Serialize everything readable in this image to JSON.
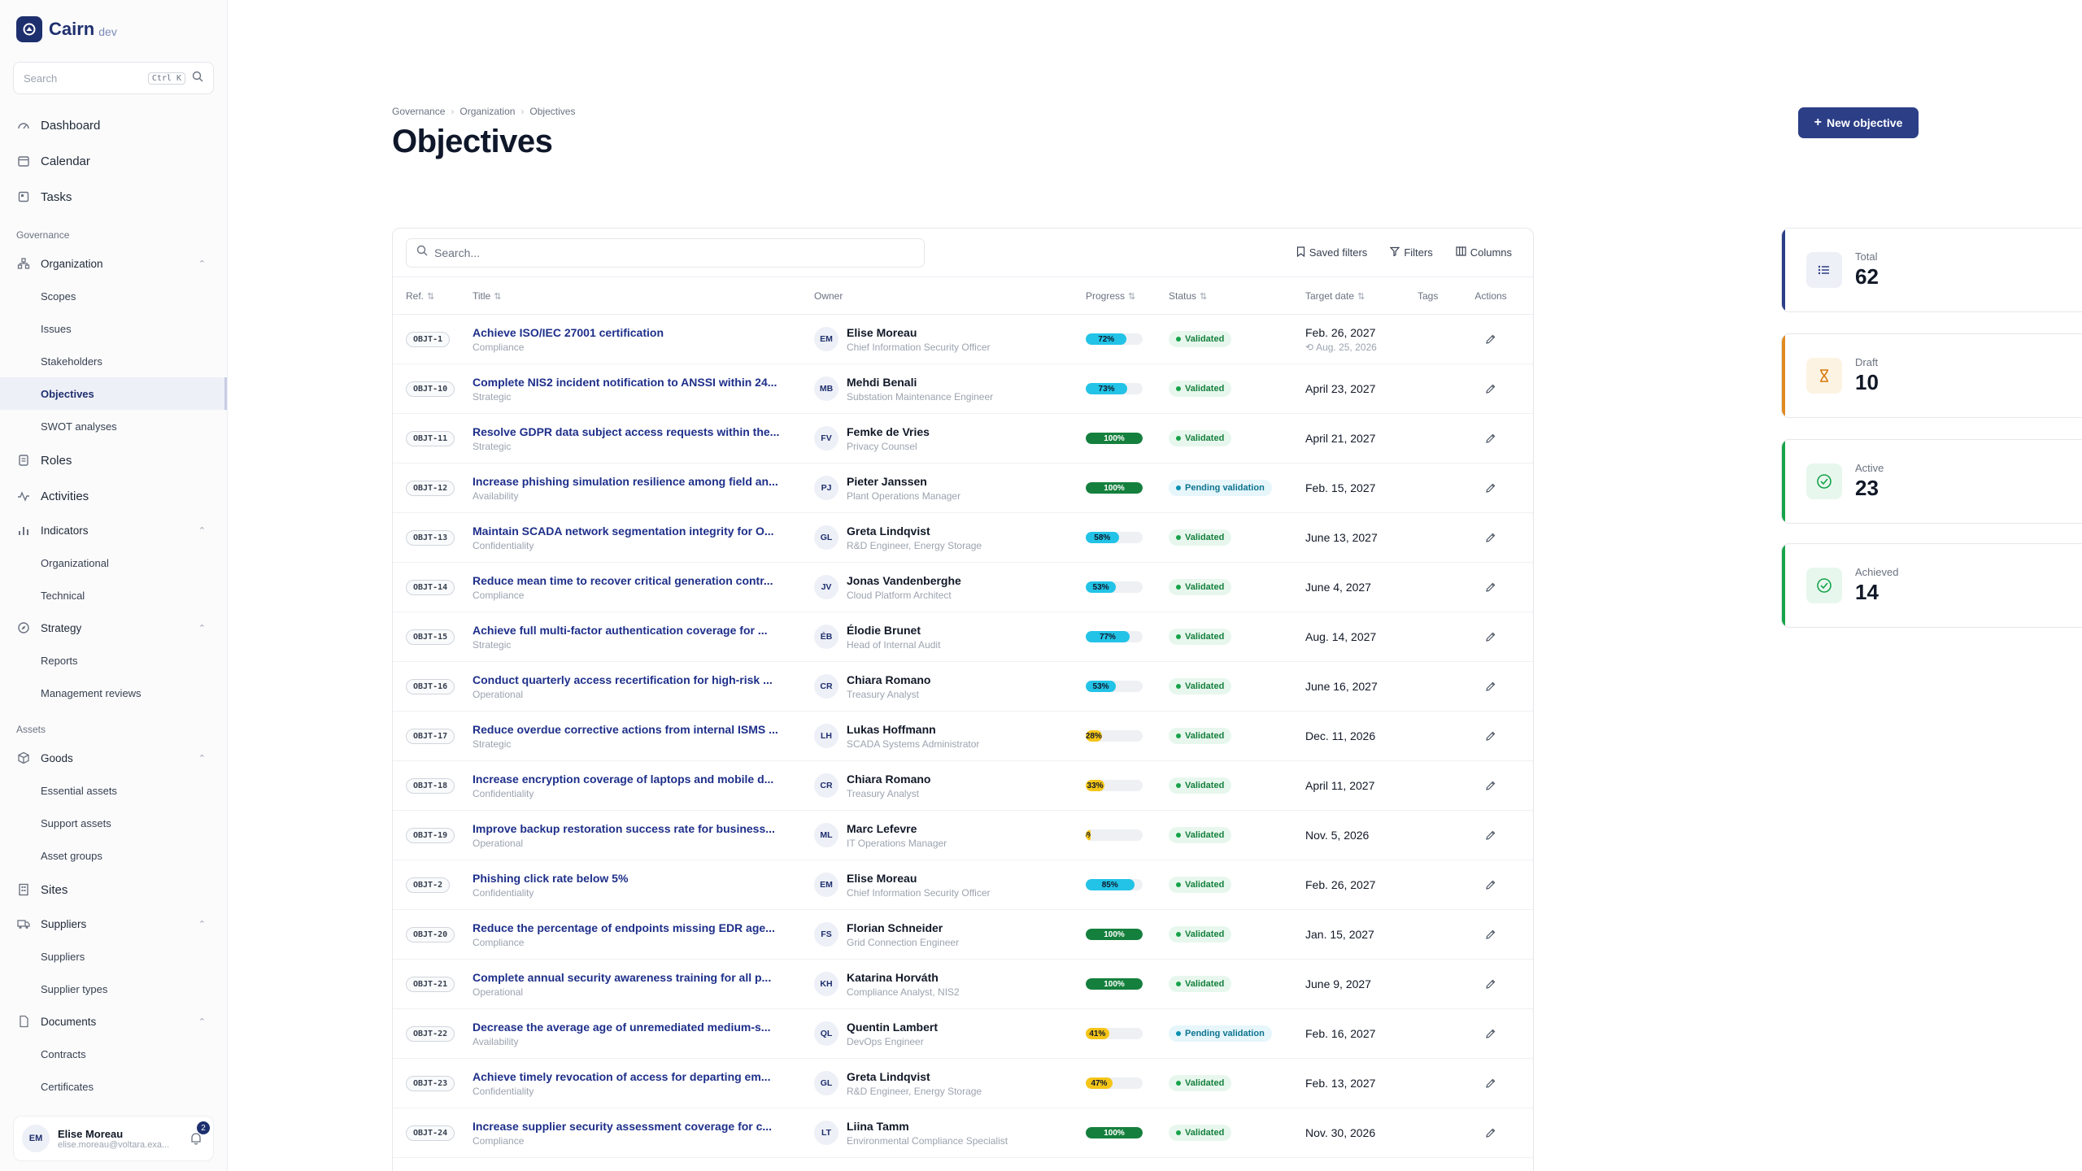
{
  "brand": {
    "name": "Cairn",
    "env": "dev"
  },
  "sidebar": {
    "search_placeholder": "Search",
    "search_shortcut": "Ctrl K",
    "top_items": [
      {
        "label": "Dashboard",
        "icon": "dashboard-icon"
      },
      {
        "label": "Calendar",
        "icon": "calendar-icon"
      },
      {
        "label": "Tasks",
        "icon": "tasks-icon"
      }
    ],
    "section_governance": "Governance",
    "organization": {
      "label": "Organization",
      "children": [
        "Scopes",
        "Issues",
        "Stakeholders",
        "Objectives",
        "SWOT analyses"
      ]
    },
    "roles": "Roles",
    "activities": "Activities",
    "indicators": {
      "label": "Indicators",
      "children": [
        "Organizational",
        "Technical"
      ]
    },
    "strategy": {
      "label": "Strategy",
      "children": [
        "Reports",
        "Management reviews"
      ]
    },
    "section_assets": "Assets",
    "goods": {
      "label": "Goods",
      "children": [
        "Essential assets",
        "Support assets",
        "Asset groups"
      ]
    },
    "sites": "Sites",
    "suppliers": {
      "label": "Suppliers",
      "children": [
        "Suppliers",
        "Supplier types"
      ]
    },
    "documents": {
      "label": "Documents",
      "children": [
        "Contracts",
        "Certificates"
      ]
    },
    "user": {
      "initials": "EM",
      "name": "Elise Moreau",
      "email": "elise.moreau@voltara.exa...",
      "notifications": "2"
    }
  },
  "breadcrumb": [
    "Governance",
    "Organization",
    "Objectives"
  ],
  "page_title": "Objectives",
  "new_button": "New objective",
  "toolbar": {
    "search_placeholder": "Search...",
    "saved_filters": "Saved filters",
    "filters": "Filters",
    "columns": "Columns"
  },
  "columns": {
    "ref": "Ref.",
    "title": "Title",
    "owner": "Owner",
    "progress": "Progress",
    "status": "Status",
    "target_date": "Target date",
    "tags": "Tags",
    "actions": "Actions"
  },
  "rows": [
    {
      "ref": "OBJT-1",
      "title": "Achieve ISO/IEC 27001 certification",
      "category": "Compliance",
      "initials": "EM",
      "owner": "Elise Moreau",
      "role": "Chief Information Security Officer",
      "progress": 72,
      "progress_label": "72%",
      "status": "Validated",
      "date": "Feb. 26, 2027",
      "date_sub": "Aug. 25, 2026"
    },
    {
      "ref": "OBJT-10",
      "title": "Complete NIS2 incident notification to ANSSI within 24...",
      "category": "Strategic",
      "initials": "MB",
      "owner": "Mehdi Benali",
      "role": "Substation Maintenance Engineer",
      "progress": 73,
      "progress_label": "73%",
      "status": "Validated",
      "date": "April 23, 2027",
      "date_sub": ""
    },
    {
      "ref": "OBJT-11",
      "title": "Resolve GDPR data subject access requests within the...",
      "category": "Strategic",
      "initials": "FV",
      "owner": "Femke de Vries",
      "role": "Privacy Counsel",
      "progress": 100,
      "progress_label": "100%",
      "status": "Validated",
      "date": "April 21, 2027",
      "date_sub": ""
    },
    {
      "ref": "OBJT-12",
      "title": "Increase phishing simulation resilience among field an...",
      "category": "Availability",
      "initials": "PJ",
      "owner": "Pieter Janssen",
      "role": "Plant Operations Manager",
      "progress": 100,
      "progress_label": "100%",
      "status": "Pending validation",
      "date": "Feb. 15, 2027",
      "date_sub": ""
    },
    {
      "ref": "OBJT-13",
      "title": "Maintain SCADA network segmentation integrity for O...",
      "category": "Confidentiality",
      "initials": "GL",
      "owner": "Greta Lindqvist",
      "role": "R&D Engineer, Energy Storage",
      "progress": 58,
      "progress_label": "58%",
      "status": "Validated",
      "date": "June 13, 2027",
      "date_sub": ""
    },
    {
      "ref": "OBJT-14",
      "title": "Reduce mean time to recover critical generation contr...",
      "category": "Compliance",
      "initials": "JV",
      "owner": "Jonas Vandenberghe",
      "role": "Cloud Platform Architect",
      "progress": 53,
      "progress_label": "53%",
      "status": "Validated",
      "date": "June 4, 2027",
      "date_sub": ""
    },
    {
      "ref": "OBJT-15",
      "title": "Achieve full multi-factor authentication coverage for ...",
      "category": "Strategic",
      "initials": "ÉB",
      "owner": "Élodie Brunet",
      "role": "Head of Internal Audit",
      "progress": 77,
      "progress_label": "77%",
      "status": "Validated",
      "date": "Aug. 14, 2027",
      "date_sub": ""
    },
    {
      "ref": "OBJT-16",
      "title": "Conduct quarterly access recertification for high-risk ...",
      "category": "Operational",
      "initials": "CR",
      "owner": "Chiara Romano",
      "role": "Treasury Analyst",
      "progress": 53,
      "progress_label": "53%",
      "status": "Validated",
      "date": "June 16, 2027",
      "date_sub": ""
    },
    {
      "ref": "OBJT-17",
      "title": "Reduce overdue corrective actions from internal ISMS ...",
      "category": "Strategic",
      "initials": "LH",
      "owner": "Lukas Hoffmann",
      "role": "SCADA Systems Administrator",
      "progress": 28,
      "progress_label": "28%",
      "status": "Validated",
      "date": "Dec. 11, 2026",
      "date_sub": ""
    },
    {
      "ref": "OBJT-18",
      "title": "Increase encryption coverage of laptops and mobile d...",
      "category": "Confidentiality",
      "initials": "CR",
      "owner": "Chiara Romano",
      "role": "Treasury Analyst",
      "progress": 33,
      "progress_label": "33%",
      "status": "Validated",
      "date": "April 11, 2027",
      "date_sub": ""
    },
    {
      "ref": "OBJT-19",
      "title": "Improve backup restoration success rate for business...",
      "category": "Operational",
      "initials": "ML",
      "owner": "Marc Lefevre",
      "role": "IT Operations Manager",
      "progress": 8,
      "progress_label": "8%",
      "status": "Validated",
      "date": "Nov. 5, 2026",
      "date_sub": ""
    },
    {
      "ref": "OBJT-2",
      "title": "Phishing click rate below 5%",
      "category": "Confidentiality",
      "initials": "EM",
      "owner": "Elise Moreau",
      "role": "Chief Information Security Officer",
      "progress": 85,
      "progress_label": "85%",
      "status": "Validated",
      "date": "Feb. 26, 2027",
      "date_sub": ""
    },
    {
      "ref": "OBJT-20",
      "title": "Reduce the percentage of endpoints missing EDR age...",
      "category": "Compliance",
      "initials": "FS",
      "owner": "Florian Schneider",
      "role": "Grid Connection Engineer",
      "progress": 100,
      "progress_label": "100%",
      "status": "Validated",
      "date": "Jan. 15, 2027",
      "date_sub": ""
    },
    {
      "ref": "OBJT-21",
      "title": "Complete annual security awareness training for all p...",
      "category": "Operational",
      "initials": "KH",
      "owner": "Katarina Horváth",
      "role": "Compliance Analyst, NIS2",
      "progress": 100,
      "progress_label": "100%",
      "status": "Validated",
      "date": "June 9, 2027",
      "date_sub": ""
    },
    {
      "ref": "OBJT-22",
      "title": "Decrease the average age of unremediated medium-s...",
      "category": "Availability",
      "initials": "QL",
      "owner": "Quentin Lambert",
      "role": "DevOps Engineer",
      "progress": 41,
      "progress_label": "41%",
      "status": "Pending validation",
      "date": "Feb. 16, 2027",
      "date_sub": ""
    },
    {
      "ref": "OBJT-23",
      "title": "Achieve timely revocation of access for departing em...",
      "category": "Confidentiality",
      "initials": "GL",
      "owner": "Greta Lindqvist",
      "role": "R&D Engineer, Energy Storage",
      "progress": 47,
      "progress_label": "47%",
      "status": "Validated",
      "date": "Feb. 13, 2027",
      "date_sub": ""
    },
    {
      "ref": "OBJT-24",
      "title": "Increase supplier security assessment coverage for c...",
      "category": "Compliance",
      "initials": "LT",
      "owner": "Liina Tamm",
      "role": "Environmental Compliance Specialist",
      "progress": 100,
      "progress_label": "100%",
      "status": "Validated",
      "date": "Nov. 30, 2026",
      "date_sub": ""
    }
  ],
  "stats": [
    {
      "label": "Total",
      "value": "62",
      "icon": "list-icon",
      "color": "blue"
    },
    {
      "label": "Draft",
      "value": "10",
      "icon": "hourglass-icon",
      "color": "orange"
    },
    {
      "label": "Active",
      "value": "23",
      "icon": "check-circle-icon",
      "color": "green"
    },
    {
      "label": "Achieved",
      "value": "14",
      "icon": "check-circle-icon",
      "color": "green"
    }
  ],
  "colors": {
    "brand": "#1e2f6e",
    "progress_high": "#15803d",
    "progress_mid": "#22c3e6",
    "progress_low": "#f5c518",
    "validated": "#16a34a",
    "pending": "#0891b2"
  }
}
